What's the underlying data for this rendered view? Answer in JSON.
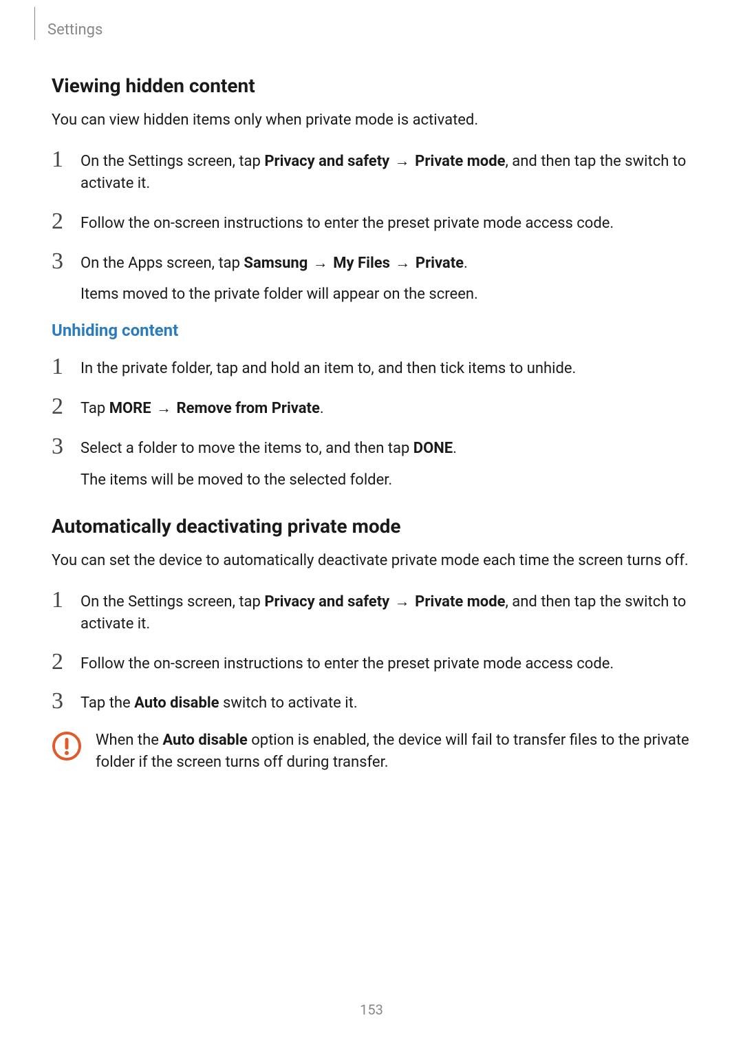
{
  "header": {
    "breadcrumb": "Settings"
  },
  "section1": {
    "title": "Viewing hidden content",
    "intro": "You can view hidden items only when private mode is activated.",
    "steps": [
      {
        "num": "1",
        "pre": "On the Settings screen, tap ",
        "b1": "Privacy and safety",
        "arrow1": " → ",
        "b2": "Private mode",
        "post": ", and then tap the switch to activate it."
      },
      {
        "num": "2",
        "text": "Follow the on-screen instructions to enter the preset private mode access code."
      },
      {
        "num": "3",
        "pre": "On the Apps screen, tap ",
        "b1": "Samsung",
        "arrow1": " → ",
        "b2": "My Files",
        "arrow2": " → ",
        "b3": "Private",
        "post": ".",
        "extra": "Items moved to the private folder will appear on the screen."
      }
    ]
  },
  "subsection": {
    "title": "Unhiding content",
    "steps": [
      {
        "num": "1",
        "text": "In the private folder, tap and hold an item to, and then tick items to unhide."
      },
      {
        "num": "2",
        "pre": "Tap ",
        "b1": "MORE",
        "arrow1": " → ",
        "b2": "Remove from Private",
        "post": "."
      },
      {
        "num": "3",
        "pre": "Select a folder to move the items to, and then tap ",
        "b1": "DONE",
        "post": ".",
        "extra": "The items will be moved to the selected folder."
      }
    ]
  },
  "section2": {
    "title": "Automatically deactivating private mode",
    "intro": "You can set the device to automatically deactivate private mode each time the screen turns off.",
    "steps": [
      {
        "num": "1",
        "pre": "On the Settings screen, tap ",
        "b1": "Privacy and safety",
        "arrow1": " → ",
        "b2": "Private mode",
        "post": ", and then tap the switch to activate it."
      },
      {
        "num": "2",
        "text": "Follow the on-screen instructions to enter the preset private mode access code."
      },
      {
        "num": "3",
        "pre": "Tap the ",
        "b1": "Auto disable",
        "post": " switch to activate it."
      }
    ],
    "note": {
      "pre": "When the ",
      "b1": "Auto disable",
      "post": " option is enabled, the device will fail to transfer files to the private folder if the screen turns off during transfer."
    }
  },
  "page_number": "153"
}
